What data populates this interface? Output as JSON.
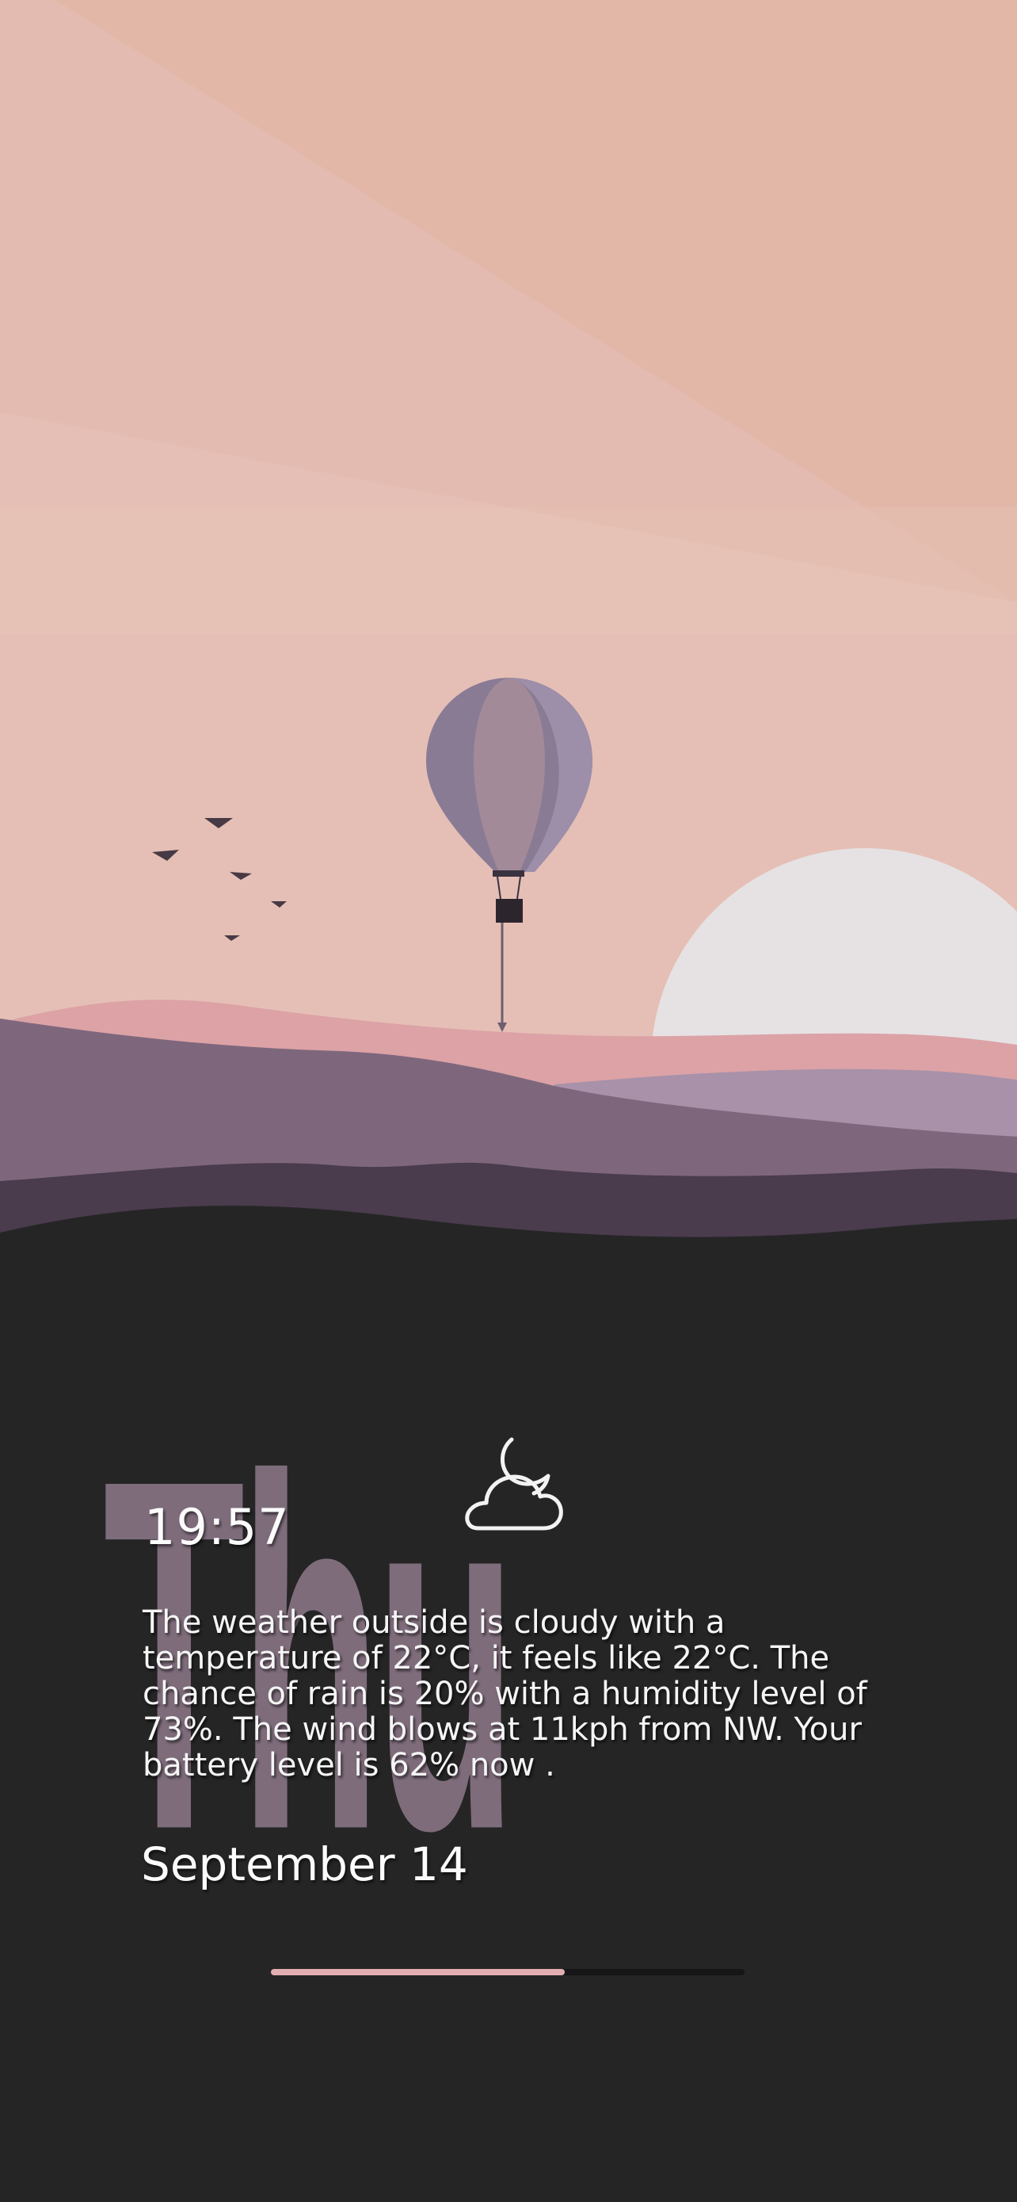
{
  "widget": {
    "day": "Thu",
    "time": "19:57",
    "weather_icon": "cloud-moon-icon",
    "summary": "The weather outside is cloudy with a temperature of 22°C, it feels like 22°C. The chance of rain is 20% with a humidity level of 73%. The wind blows at 11kph from NW. Your battery level is 62% now .",
    "date": "September 14",
    "battery_level": 0.62
  },
  "colors": {
    "background": "#252525",
    "day_text": "#7e6c7b",
    "battery_fill": "#e3aeb1",
    "sky": "#e4bfb4"
  }
}
